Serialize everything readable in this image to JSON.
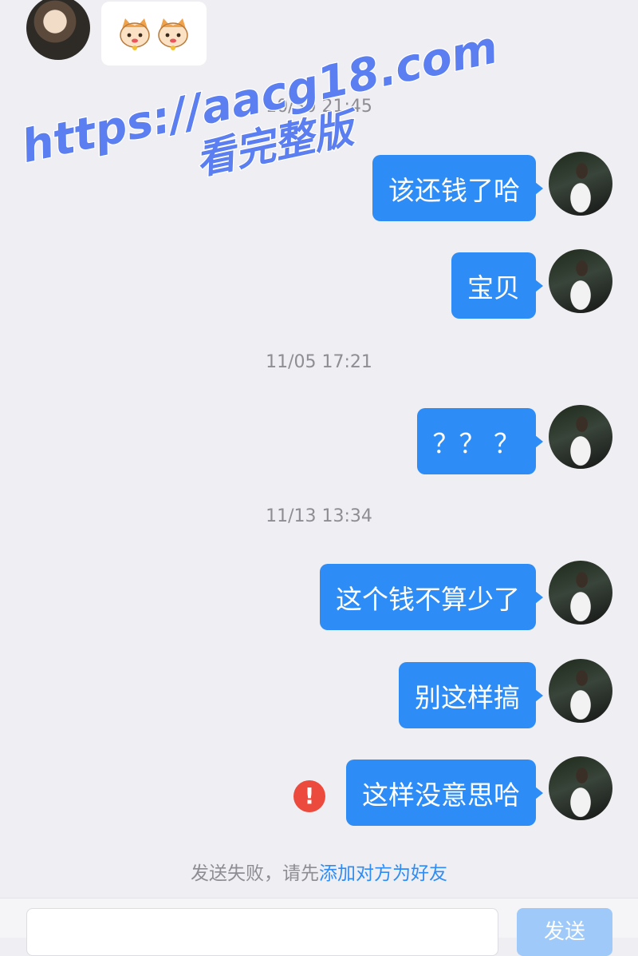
{
  "messages": {
    "ts1": "10/30 21:45",
    "msg1": "该还钱了哈",
    "msg2": "宝贝",
    "ts2": "11/05 17:21",
    "msg3": "？？ ？",
    "ts3": "11/13 13:34",
    "msg4": "这个钱不算少了",
    "msg5": "别这样搞",
    "msg6": "这样没意思哈"
  },
  "status": {
    "error_mark": "!",
    "fail_prefix": "发送失败，请先",
    "fail_link": "添加对方为好友"
  },
  "composer": {
    "send_label": "发送"
  },
  "watermark": {
    "line1": "https://aacg18.com",
    "line2": "看完整版"
  },
  "colors": {
    "bubble": "#2d8cf5",
    "error": "#ec4a3c",
    "watermark": "#5b7ef0"
  },
  "icons": {
    "sticker": "lucky-cat-icon",
    "error": "exclamation-icon"
  }
}
